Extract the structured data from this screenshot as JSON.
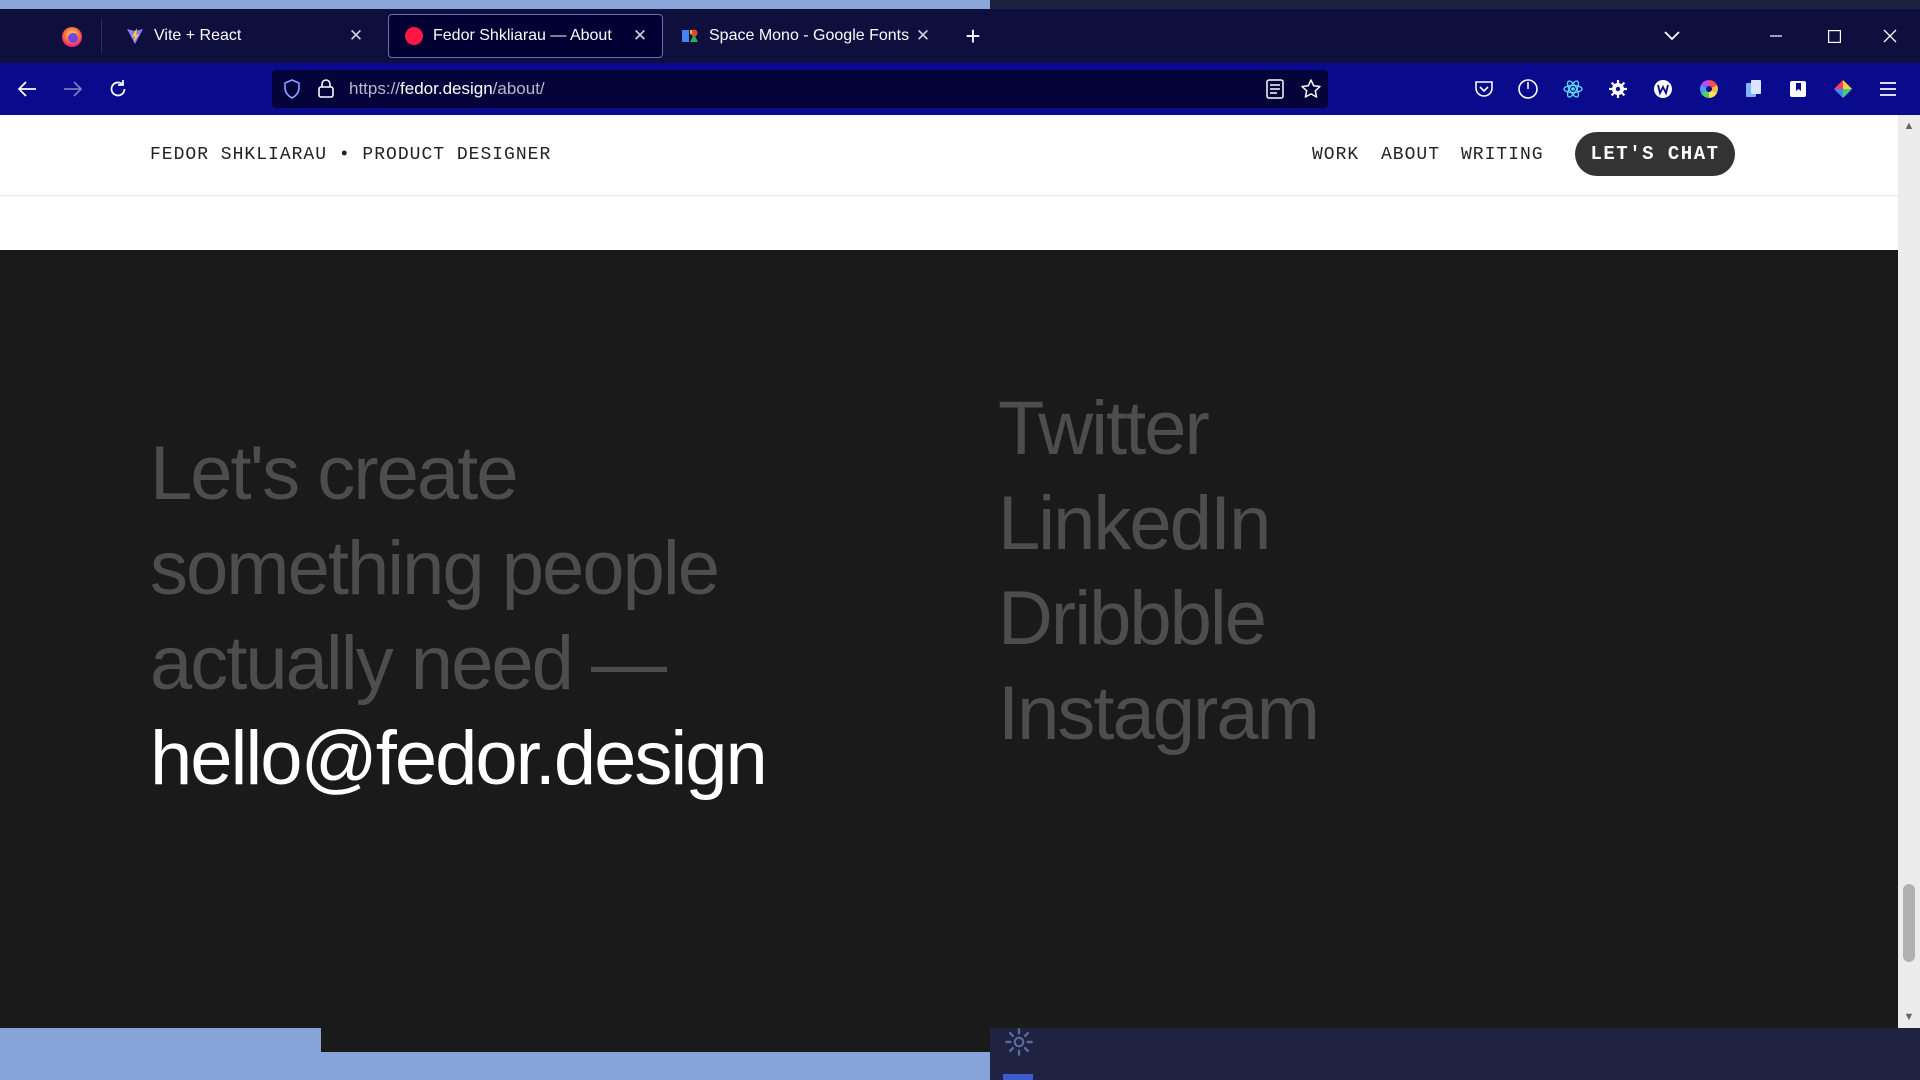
{
  "browser": {
    "tabs": [
      {
        "title": "Vite + React",
        "favicon": "vite-favicon",
        "active": false
      },
      {
        "title": "Fedor Shkliarau — About",
        "favicon": "red-dot-favicon",
        "active": true
      },
      {
        "title": "Space Mono - Google Fonts",
        "favicon": "google-fonts-favicon",
        "active": false
      }
    ],
    "url_prefix": "https://",
    "url_domain": "fedor.design",
    "url_path": "/about/"
  },
  "site": {
    "brand": "FEDOR SHKLIARAU • PRODUCT DESIGNER",
    "nav": [
      {
        "label": "WORK"
      },
      {
        "label": "ABOUT"
      },
      {
        "label": "WRITING"
      }
    ],
    "cta_label": "LET'S CHAT"
  },
  "contact": {
    "lines": [
      "Let's create",
      "something people",
      "actually need —"
    ],
    "email": "hello@fedor.design",
    "socials": [
      "Twitter",
      "LinkedIn",
      "Dribbble",
      "Instagram"
    ]
  },
  "colors": {
    "tab_bar": "#0f0f3d",
    "nav_bar": "#0a0a8c",
    "page_dark": "#1a1a1a",
    "muted_text": "#4d4d4d",
    "cta_bg": "#333333"
  }
}
